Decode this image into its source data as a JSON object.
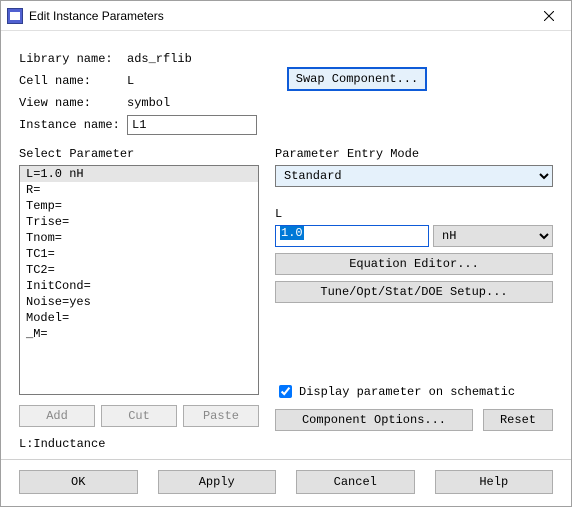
{
  "window": {
    "title": "Edit Instance Parameters"
  },
  "fields": {
    "library_label": "Library name:",
    "library_value": "ads_rflib",
    "cell_label": "Cell name:",
    "cell_value": "L",
    "view_label": "View name:",
    "view_value": "symbol",
    "instance_label": "Instance name:",
    "instance_value": "L1"
  },
  "swap_button": "Swap Component...",
  "left": {
    "section": "Select Parameter",
    "items": [
      "L=1.0 nH",
      "R=",
      "Temp=",
      "Trise=",
      "Tnom=",
      "TC1=",
      "TC2=",
      "InitCond=",
      "Noise=yes",
      "Model=",
      "_M="
    ],
    "selected_index": 0,
    "add": "Add",
    "cut": "Cut",
    "paste": "Paste"
  },
  "right": {
    "mode_label": "Parameter Entry Mode",
    "mode_value": "Standard",
    "param_name": "L",
    "param_value": "1.0",
    "unit": "nH",
    "eq_editor": "Equation Editor...",
    "tune_setup": "Tune/Opt/Stat/DOE Setup...",
    "display_check_label": "Display parameter on schematic",
    "display_checked": true,
    "comp_options": "Component Options...",
    "reset": "Reset"
  },
  "status": "L:Inductance",
  "footer": {
    "ok": "OK",
    "apply": "Apply",
    "cancel": "Cancel",
    "help": "Help"
  }
}
